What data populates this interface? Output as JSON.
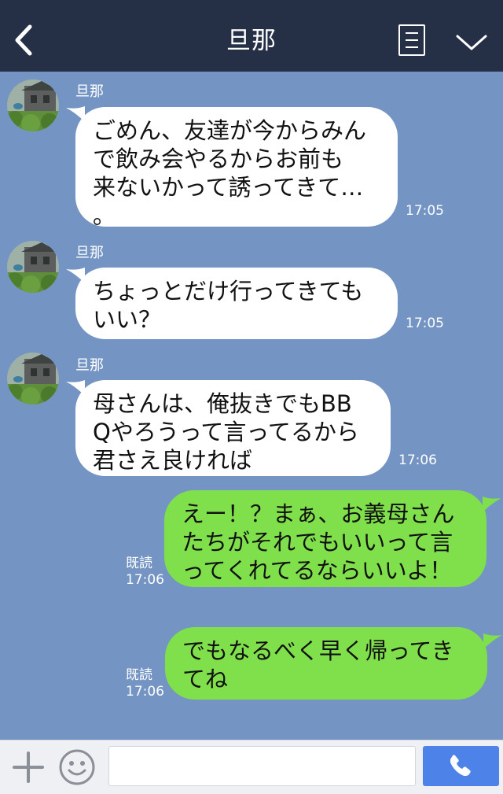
{
  "header": {
    "title": "旦那"
  },
  "messages": [
    {
      "side": "in",
      "sender": "旦那",
      "lines": [
        "ごめん、友達が今からみん",
        "で飲み会やるからお前も",
        "来ないかって誘ってきて…",
        "。"
      ],
      "time": "17:05"
    },
    {
      "side": "in",
      "sender": "旦那",
      "lines": [
        "ちょっとだけ行ってきても",
        "いい？"
      ],
      "time": "17:05"
    },
    {
      "side": "in",
      "sender": "旦那",
      "lines": [
        "母さんは、俺抜きでもBB",
        "Qやろうって言ってるから",
        "君さえ良ければ"
      ],
      "time": "17:06"
    },
    {
      "side": "out",
      "read": "既読",
      "lines": [
        "えー！？まぁ、お義母さん",
        "たちがそれでもいいって言",
        "ってくれてるならいいよ！"
      ],
      "time": "17:06"
    },
    {
      "side": "out",
      "read": "既読",
      "lines": [
        "でもなるべく早く帰ってき",
        "てね"
      ],
      "time": "17:06"
    }
  ],
  "footer": {
    "input_value": ""
  },
  "colors": {
    "header_bg": "#253047",
    "chat_bg": "#7494c3",
    "incoming_bubble": "#ffffff",
    "outgoing_bubble": "#80e04b",
    "send_button": "#4d82e8"
  },
  "icons": [
    "back-arrow-icon",
    "menu-icon",
    "chevron-down-icon",
    "plus-icon",
    "emoji-icon",
    "phone-icon"
  ]
}
